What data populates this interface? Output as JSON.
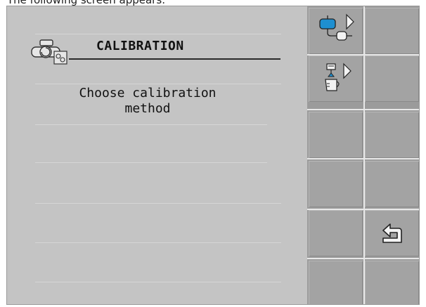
{
  "caption": "The following screen appears:",
  "screen": {
    "title": "CALIBRATION",
    "prompt_line1": "Choose calibration",
    "prompt_line2": "method"
  },
  "softkeys": [
    {
      "icon": "tank-flow-calibration-icon"
    },
    {
      "icon": "nozzle-measuring-jug-calibration-icon"
    },
    {
      "icon": "empty"
    },
    {
      "icon": "empty"
    },
    {
      "icon": "back-icon"
    },
    {
      "icon": "empty"
    }
  ],
  "colors": {
    "screen_bg": "#c4c4c4",
    "softkey_bg": "#a3a3a3",
    "accent_blue": "#1e8fd0"
  }
}
